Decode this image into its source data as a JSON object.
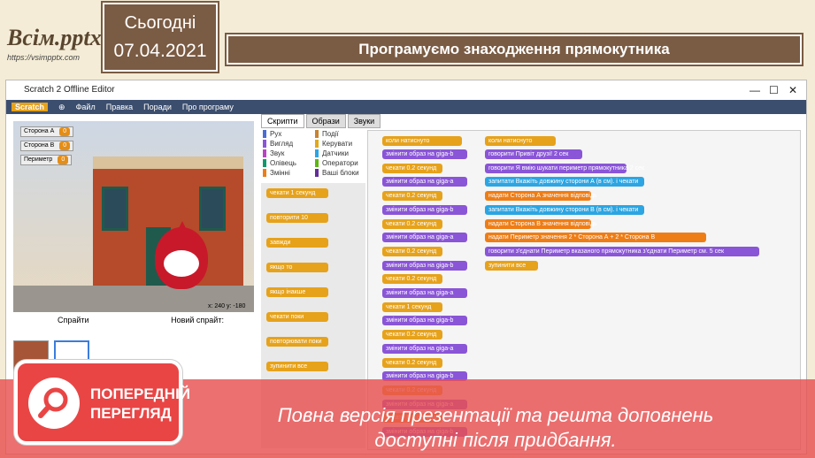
{
  "logo": {
    "brand": "Всім.pptx",
    "url": "https://vsimpptx.com"
  },
  "date": {
    "label": "Сьогодні",
    "value": "07.04.2021"
  },
  "slide_title": "Програмуємо знаходження прямокутника",
  "window": {
    "title": "Scratch 2 Offline Editor",
    "menu": [
      "Scratch",
      "Файл",
      "Правка",
      "Поради",
      "Про програму"
    ]
  },
  "monitors": [
    {
      "label": "Сторона А",
      "value": "0"
    },
    {
      "label": "Сторона В",
      "value": "0"
    },
    {
      "label": "Периметр",
      "value": "0"
    }
  ],
  "coords": "x: 240  y: -180",
  "sprites_panel": {
    "label": "Спрайти",
    "new_sprite": "Новий спрайт:"
  },
  "tabs": [
    "Скрипти",
    "Образи",
    "Звуки"
  ],
  "categories": [
    {
      "name": "Рух",
      "color": "#4a6cd4"
    },
    {
      "name": "Події",
      "color": "#c88330"
    },
    {
      "name": "Вигляд",
      "color": "#8a55d7"
    },
    {
      "name": "Керувати",
      "color": "#e1a91a"
    },
    {
      "name": "Звук",
      "color": "#bb42c3"
    },
    {
      "name": "Датчики",
      "color": "#2ca5e2"
    },
    {
      "name": "Олівець",
      "color": "#0e9a6c"
    },
    {
      "name": "Оператори",
      "color": "#5cb712"
    },
    {
      "name": "Змінні",
      "color": "#ee7d16"
    },
    {
      "name": "Ваші блоки",
      "color": "#632d99"
    }
  ],
  "palette_blocks": [
    "чекати 1 секунд",
    "повторити 10",
    "завжди",
    "якщо то",
    "якщо інакше",
    "чекати поки",
    "повторювати поки",
    "зупинити все"
  ],
  "script1": {
    "hat": "коли натиснуто",
    "rows": [
      "змінити образ на giga-b",
      "чекати 0.2 секунд",
      "змінити образ на giga-a",
      "чекати 0.2 секунд",
      "змінити образ на giga-b",
      "чекати 0.2 секунд",
      "змінити образ на giga-a",
      "чекати 0.2 секунд",
      "змінити образ на giga-b",
      "чекати 0.2 секунд",
      "змінити образ на giga-a",
      "чекати 1 секунд",
      "змінити образ на giga-b",
      "чекати 0.2 секунд",
      "змінити образ на giga-a",
      "чекати 0.2 секунд",
      "змінити образ на giga-b",
      "чекати 0.2 секунд",
      "змінити образ на giga-a",
      "чекати 0.2 секунд",
      "змінити образ на giga-b"
    ]
  },
  "script2": {
    "hat": "коли натиснуто",
    "rows": [
      {
        "t": "говорити Привіт друзі! 2 сек",
        "c": "look"
      },
      {
        "t": "говорити Я вмію шукати периметр прямокутника 2 сек",
        "c": "look"
      },
      {
        "t": "запитати Вкажіть довжину сторони А (в см). і чекати",
        "c": "sens"
      },
      {
        "t": "надати Сторона А значення відповідь",
        "c": "data"
      },
      {
        "t": "запитати Вкажіть довжину сторони В (в см). і чекати",
        "c": "sens"
      },
      {
        "t": "надати Сторона В значення відповідь",
        "c": "data"
      },
      {
        "t": "надати Периметр значення 2 * Сторона А + 2 * Сторона В",
        "c": "data"
      },
      {
        "t": "говорити з'єднати Периметр вказаного прямокутника з'єднати Периметр см. 5 сек",
        "c": "look"
      },
      {
        "t": "зупинити все",
        "c": "ctl"
      }
    ]
  },
  "preview": {
    "line1": "ПОПЕРЕДНІЙ",
    "line2": "ПЕРЕГЛЯД"
  },
  "note": {
    "line1": "Повна версія презентації та решта доповнень",
    "line2": "доступні після придбання."
  }
}
